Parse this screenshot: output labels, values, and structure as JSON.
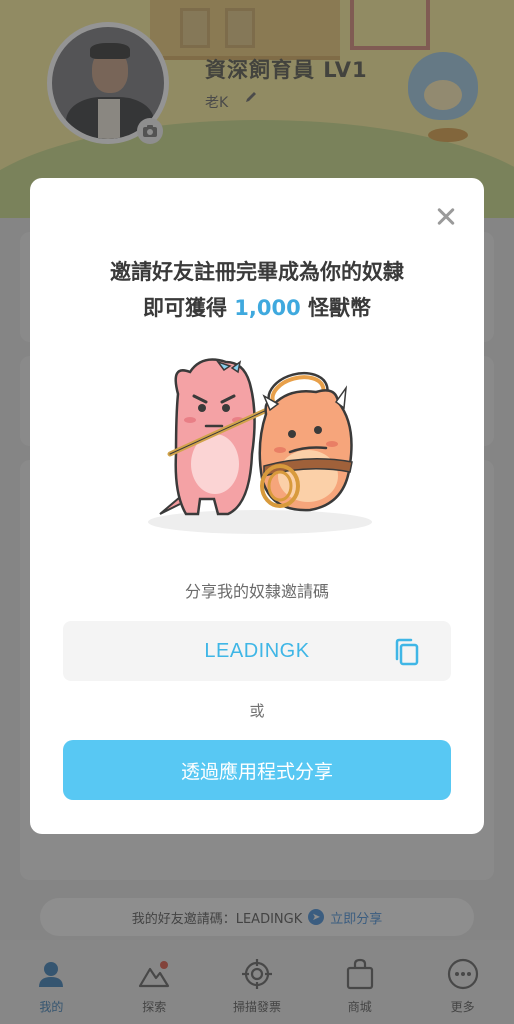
{
  "profile": {
    "title": "資深飼育員 LV1",
    "name": "老K"
  },
  "invite_bar": {
    "label": "我的好友邀請碼：LEADINGK",
    "share_label": "立即分享"
  },
  "bottom_nav": {
    "items": [
      {
        "label": "我的",
        "icon": "user-icon",
        "active": true
      },
      {
        "label": "探索",
        "icon": "mountain-icon",
        "active": false
      },
      {
        "label": "掃描發票",
        "icon": "target-icon",
        "active": false
      },
      {
        "label": "商城",
        "icon": "shopping-bag-icon",
        "active": false
      },
      {
        "label": "更多",
        "icon": "more-icon",
        "active": false
      }
    ]
  },
  "modal": {
    "title_line1": "邀請好友註冊完畢成為你的奴隸",
    "title_line2_prefix": "即可獲得",
    "title_line2_amount": "1,000",
    "title_line2_suffix": "怪獸幣",
    "share_caption": "分享我的奴隸邀請碼",
    "invite_code": "LEADINGK",
    "or_text": "或",
    "share_button_label": "透過應用程式分享"
  },
  "colors": {
    "accent": "#3fa9de",
    "button": "#58c8f3",
    "code_text": "#3fb6e6",
    "active_nav": "#2f6fa5"
  }
}
